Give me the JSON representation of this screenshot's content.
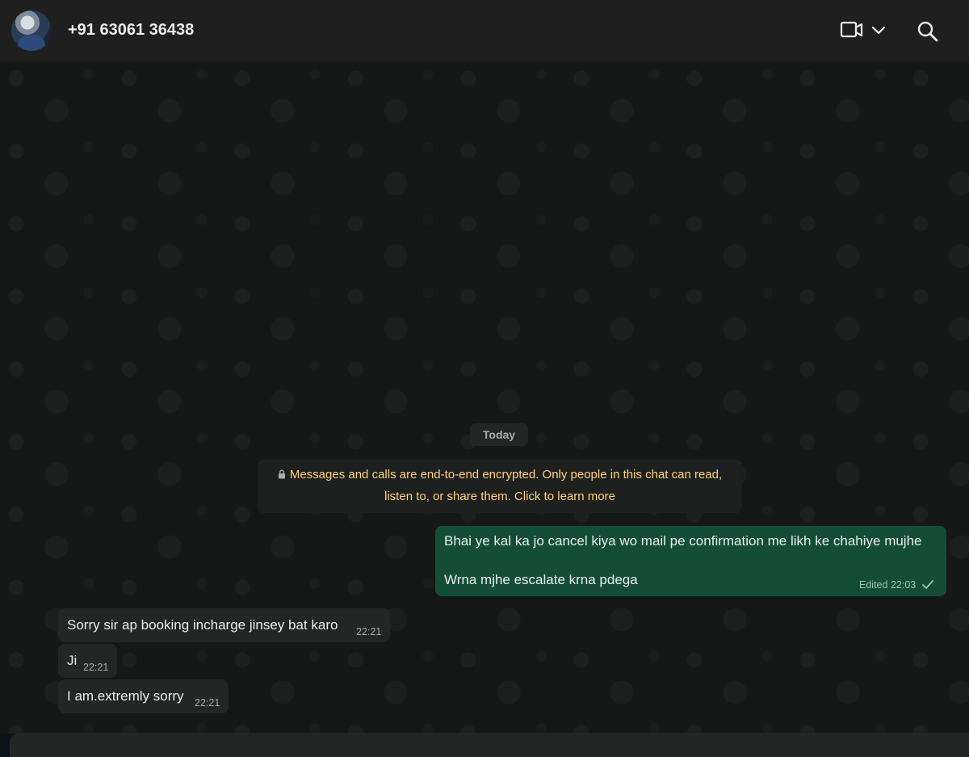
{
  "header": {
    "contact_name": "+91 63061 36438",
    "icons": [
      "avatar",
      "video-call-icon",
      "chevron-down-icon",
      "search-icon"
    ]
  },
  "chat": {
    "day_label": "Today",
    "encryption_notice": {
      "line1": "Messages and calls are end-to-end encrypted. Only people in this chat can read,",
      "line2": "listen to, or share them. Click to learn more",
      "icon": "lock-icon",
      "color": "#ffd279"
    },
    "messages": [
      {
        "direction": "outgoing",
        "line1": "Bhai ye kal ka jo cancel kiya wo mail pe confirmation me likh ke chahiye mujhe",
        "line2": "Wrna mjhe escalate krna pdega",
        "edited_label": "Edited",
        "time": "22:03",
        "status": "sent-check"
      },
      {
        "direction": "incoming",
        "text": "Sorry sir ap booking incharge jinsey bat karo",
        "time": "22:21"
      },
      {
        "direction": "incoming",
        "text": "Ji",
        "time": "22:21"
      },
      {
        "direction": "incoming",
        "text": "I am.extremly sorry",
        "time": "22:21"
      }
    ]
  },
  "colors": {
    "outgoing_bubble": "#144d37",
    "incoming_bubble": "#242626",
    "chat_background": "#161717",
    "header_background": "#1f1f1f"
  }
}
